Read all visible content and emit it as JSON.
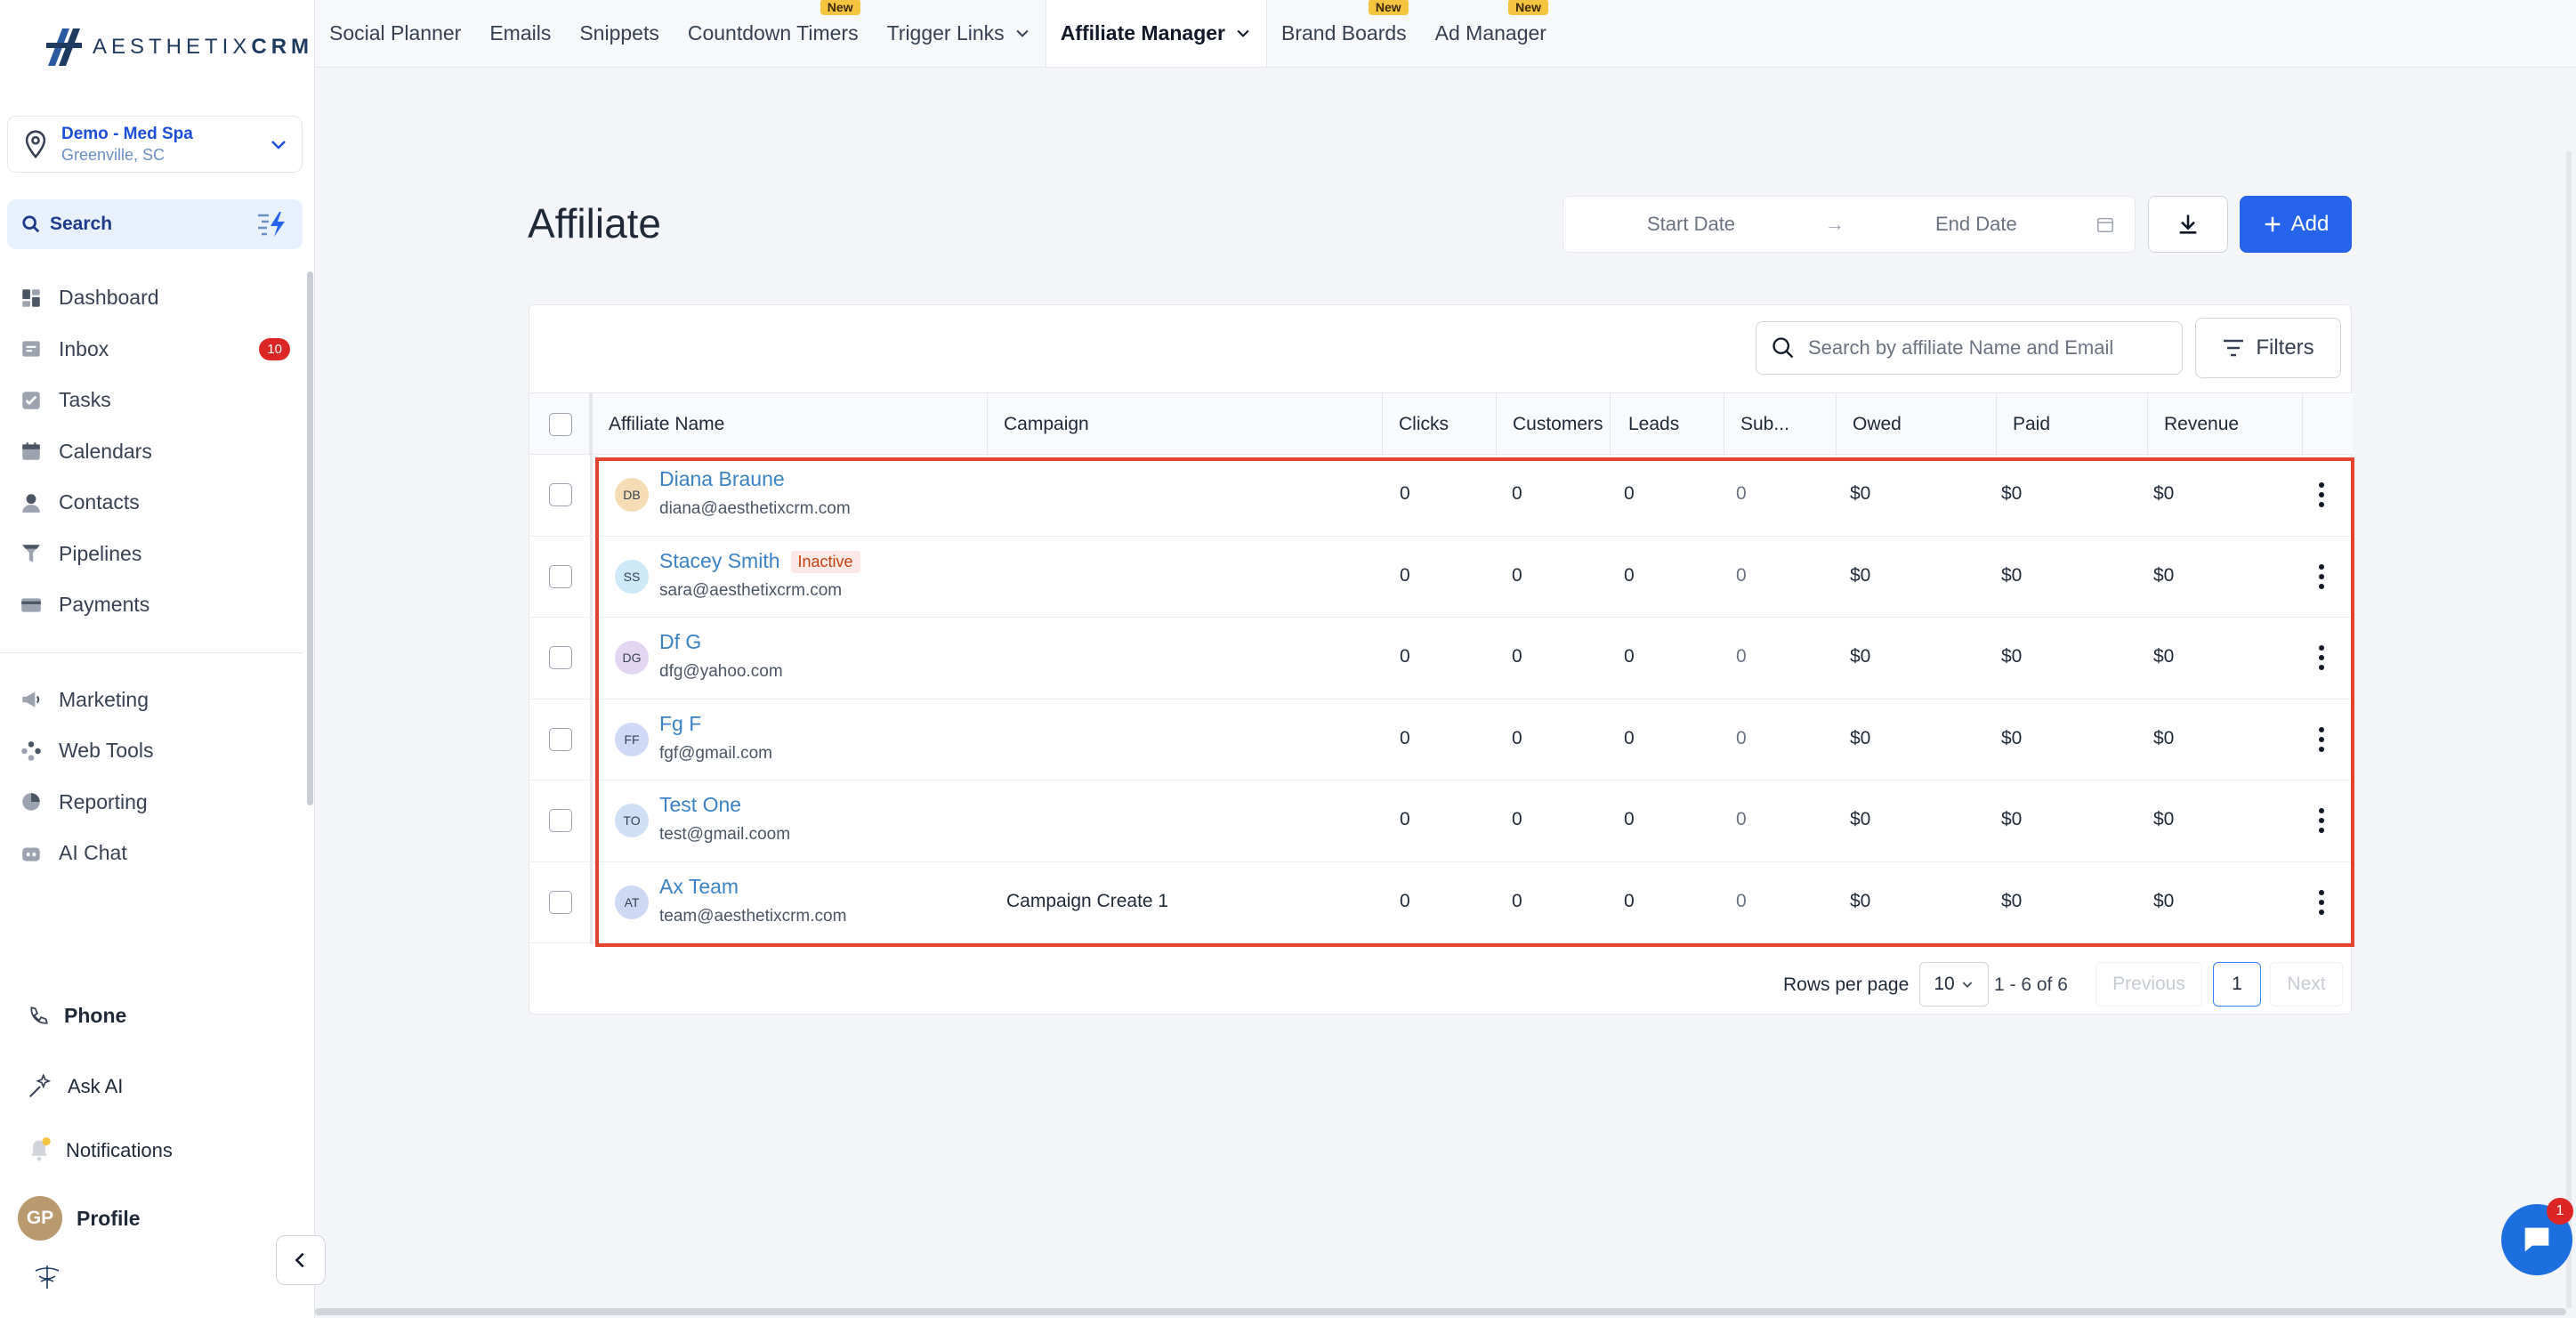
{
  "brand": {
    "logo_text_light": "AESTHETIX",
    "logo_text_bold": "CRM"
  },
  "location": {
    "name": "Demo - Med Spa",
    "city": "Greenville, SC"
  },
  "search": {
    "label": "Search"
  },
  "nav": {
    "items": [
      {
        "label": "Dashboard",
        "icon": "dashboard-icon"
      },
      {
        "label": "Inbox",
        "icon": "inbox-icon",
        "badge": "10"
      },
      {
        "label": "Tasks",
        "icon": "tasks-icon"
      },
      {
        "label": "Calendars",
        "icon": "calendar-icon"
      },
      {
        "label": "Contacts",
        "icon": "contacts-icon"
      },
      {
        "label": "Pipelines",
        "icon": "pipelines-icon"
      },
      {
        "label": "Payments",
        "icon": "payments-icon"
      }
    ],
    "secondary": [
      {
        "label": "Marketing",
        "icon": "megaphone-icon"
      },
      {
        "label": "Web Tools",
        "icon": "web-tools-icon"
      },
      {
        "label": "Reporting",
        "icon": "pie-chart-icon"
      },
      {
        "label": "AI Chat",
        "icon": "robot-icon"
      }
    ]
  },
  "bottom": {
    "phone": "Phone",
    "ask_ai": "Ask AI",
    "notifications": "Notifications",
    "profile": "Profile",
    "profile_initials": "GP"
  },
  "topnav": {
    "tabs": [
      {
        "label": "Social Planner"
      },
      {
        "label": "Emails"
      },
      {
        "label": "Snippets"
      },
      {
        "label": "Countdown Timers",
        "new": "New"
      },
      {
        "label": "Trigger Links",
        "dropdown": true
      },
      {
        "label": "Affiliate Manager",
        "dropdown": true,
        "active": true
      },
      {
        "label": "Brand Boards",
        "new": "New"
      },
      {
        "label": "Ad Manager",
        "new": "New"
      }
    ]
  },
  "page": {
    "title": "Affiliate",
    "start_date": "Start Date",
    "end_date": "End Date",
    "add_label": "Add"
  },
  "table": {
    "search_placeholder": "Search by affiliate Name and Email",
    "filters_label": "Filters",
    "columns": [
      "Affiliate Name",
      "Campaign",
      "Clicks",
      "Customers",
      "Leads",
      "Sub...",
      "Owed",
      "Paid",
      "Revenue"
    ],
    "rows": [
      {
        "initials": "DB",
        "name": "Diana Braune",
        "email": "diana@aesthetixcrm.com",
        "status": "",
        "campaign": "",
        "clicks": "0",
        "customers": "0",
        "leads": "0",
        "subs": "0",
        "owed": "$0",
        "paid": "$0",
        "revenue": "$0",
        "avatar_color": "#f5dcb4"
      },
      {
        "initials": "SS",
        "name": "Stacey Smith",
        "email": "sara@aesthetixcrm.com",
        "status": "Inactive",
        "campaign": "",
        "clicks": "0",
        "customers": "0",
        "leads": "0",
        "subs": "0",
        "owed": "$0",
        "paid": "$0",
        "revenue": "$0",
        "avatar_color": "#cde8f7"
      },
      {
        "initials": "DG",
        "name": "Df G",
        "email": "dfg@yahoo.com",
        "status": "",
        "campaign": "",
        "clicks": "0",
        "customers": "0",
        "leads": "0",
        "subs": "0",
        "owed": "$0",
        "paid": "$0",
        "revenue": "$0",
        "avatar_color": "#e2d6f2"
      },
      {
        "initials": "FF",
        "name": "Fg F",
        "email": "fgf@gmail.com",
        "status": "",
        "campaign": "",
        "clicks": "0",
        "customers": "0",
        "leads": "0",
        "subs": "0",
        "owed": "$0",
        "paid": "$0",
        "revenue": "$0",
        "avatar_color": "#cfd9f5"
      },
      {
        "initials": "TO",
        "name": "Test One",
        "email": "test@gmail.coom",
        "status": "",
        "campaign": "",
        "clicks": "0",
        "customers": "0",
        "leads": "0",
        "subs": "0",
        "owed": "$0",
        "paid": "$0",
        "revenue": "$0",
        "avatar_color": "#cfe0f5"
      },
      {
        "initials": "AT",
        "name": "Ax Team",
        "email": "team@aesthetixcrm.com",
        "status": "",
        "campaign": "Campaign Create 1",
        "clicks": "0",
        "customers": "0",
        "leads": "0",
        "subs": "0",
        "owed": "$0",
        "paid": "$0",
        "revenue": "$0",
        "avatar_color": "#cdd8f3"
      }
    ]
  },
  "pager": {
    "rows_per_page_label": "Rows per page",
    "rows_per_page": "10",
    "range": "1 - 6 of 6",
    "previous": "Previous",
    "page": "1",
    "next": "Next"
  },
  "chat": {
    "badge": "1"
  },
  "colors": {
    "accent": "#2563eb",
    "highlight": "#e4442d",
    "link": "#3b82c4"
  }
}
